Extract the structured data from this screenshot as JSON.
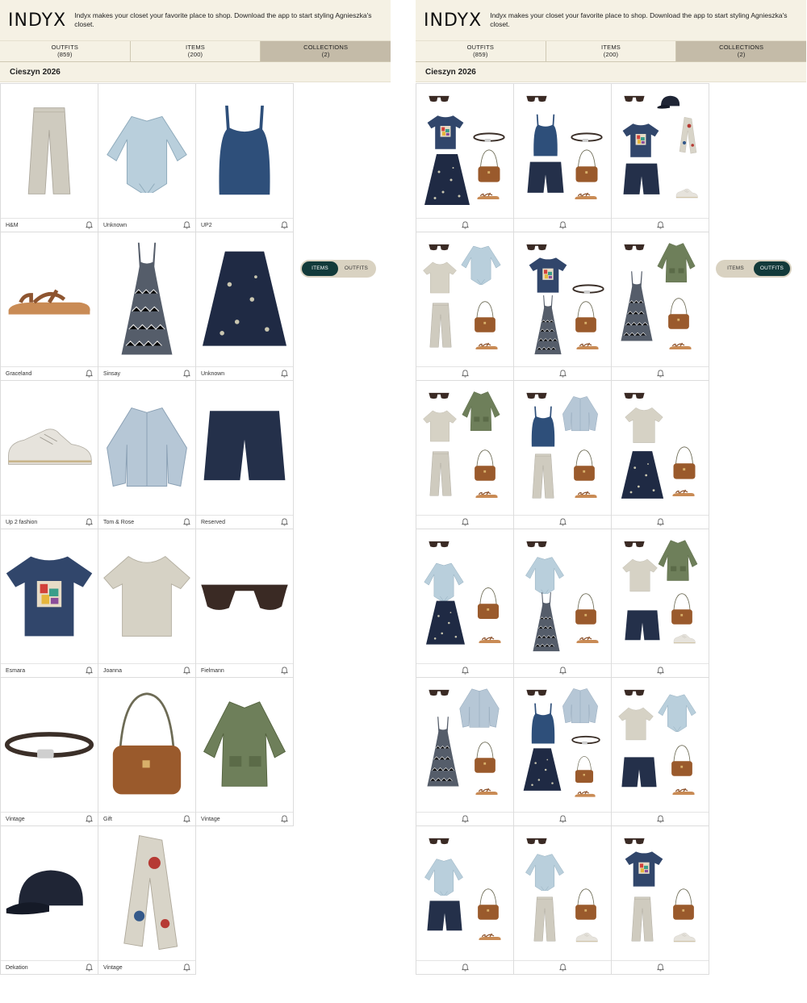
{
  "brand": "INDYX",
  "promo_text": "Indyx makes your closet your favorite place to shop. Download the app to start styling Agnieszka's closet.",
  "tabs": [
    {
      "label": "OUTFITS",
      "count": "(859)"
    },
    {
      "label": "ITEMS",
      "count": "(200)"
    },
    {
      "label": "COLLECTIONS",
      "count": "(2)"
    }
  ],
  "collection_title": "Cieszyn 2026",
  "toggle": {
    "items": "ITEMS",
    "outfits": "OUTFITS"
  },
  "items": [
    {
      "brand": "H&M",
      "icon": "wide-trousers"
    },
    {
      "brand": "Unknown",
      "icon": "light-blue-shirt"
    },
    {
      "brand": "UP2",
      "icon": "navy-tank-top"
    },
    {
      "brand": "Graceland",
      "icon": "brown-sandal"
    },
    {
      "brand": "Sinsay",
      "icon": "patterned-maxi-dress"
    },
    {
      "brand": "Unknown",
      "icon": "floral-skirt"
    },
    {
      "brand": "Up 2 fashion",
      "icon": "sneaker"
    },
    {
      "brand": "Tom & Rose",
      "icon": "denim-jacket"
    },
    {
      "brand": "Reserved",
      "icon": "navy-shorts"
    },
    {
      "brand": "Esmara",
      "icon": "graphic-tee"
    },
    {
      "brand": "Joanna",
      "icon": "beige-tee"
    },
    {
      "brand": "Fielmann",
      "icon": "sunglasses"
    },
    {
      "brand": "Vintage",
      "icon": "belt"
    },
    {
      "brand": "Gift",
      "icon": "brown-crossbody-bag"
    },
    {
      "brand": "Vintage",
      "icon": "green-utility-jacket"
    },
    {
      "brand": "Dekation",
      "icon": "navy-cap"
    },
    {
      "brand": "Vintage",
      "icon": "printed-scarf"
    }
  ],
  "outfit_count_shown": 18,
  "colors": {
    "header_bg": "#f5f1e4",
    "active_tab": "#c4bba8",
    "toggle_on": "#123a3a"
  }
}
